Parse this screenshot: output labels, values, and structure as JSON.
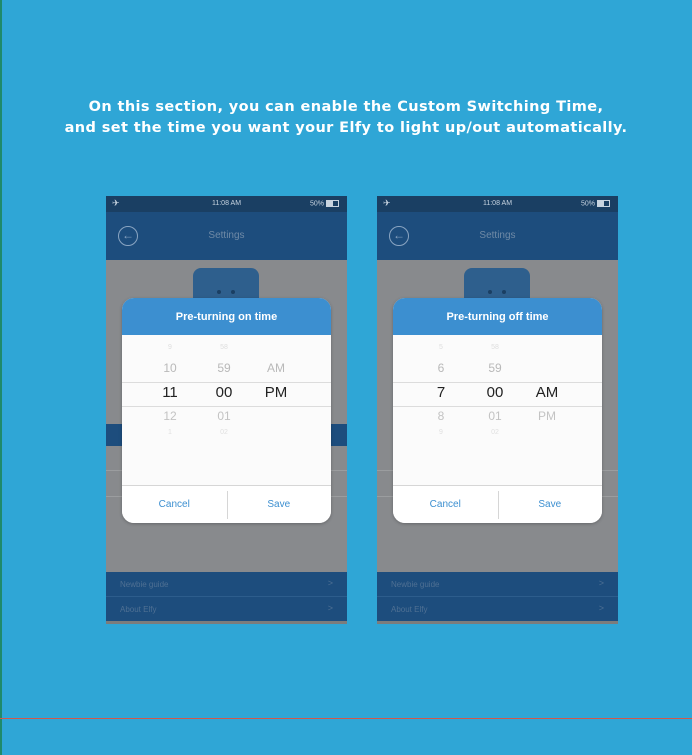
{
  "caption": {
    "line1": "On this section, you can enable the Custom Switching Time,",
    "line2": "and set the time you want your Elfy to light up/out automatically."
  },
  "phones": [
    {
      "status": {
        "airplane": "✈",
        "time": "11:08 AM",
        "battery": "50%"
      },
      "nav": {
        "back": "←",
        "title": "Settings"
      },
      "dialog": {
        "title": "Pre-turning on time",
        "hours": [
          "9",
          "10",
          "11",
          "12",
          "1"
        ],
        "minutes": [
          "58",
          "59",
          "00",
          "01",
          "02"
        ],
        "periods": [
          "",
          "AM",
          "PM",
          "",
          ""
        ],
        "cancel": "Cancel",
        "save": "Save"
      },
      "rows": [
        {
          "label": "Newbie guide",
          "chevron": ">"
        },
        {
          "label": "About Elfy",
          "chevron": ">"
        }
      ]
    },
    {
      "status": {
        "airplane": "✈",
        "time": "11:08 AM",
        "battery": "50%"
      },
      "nav": {
        "back": "←",
        "title": "Settings"
      },
      "dialog": {
        "title": "Pre-turning off time",
        "hours": [
          "5",
          "6",
          "7",
          "8",
          "9"
        ],
        "minutes": [
          "58",
          "59",
          "00",
          "01",
          "02"
        ],
        "periods": [
          "",
          "",
          "AM",
          "PM",
          ""
        ],
        "cancel": "Cancel",
        "save": "Save"
      },
      "rows": [
        {
          "label": "Newbie guide",
          "chevron": ">"
        },
        {
          "label": "About Elfy",
          "chevron": ">"
        }
      ]
    }
  ],
  "colors": {
    "background": "#2fa6d6",
    "nav_blue": "#1d4d7d",
    "dialog_header": "#3c8fd0"
  }
}
